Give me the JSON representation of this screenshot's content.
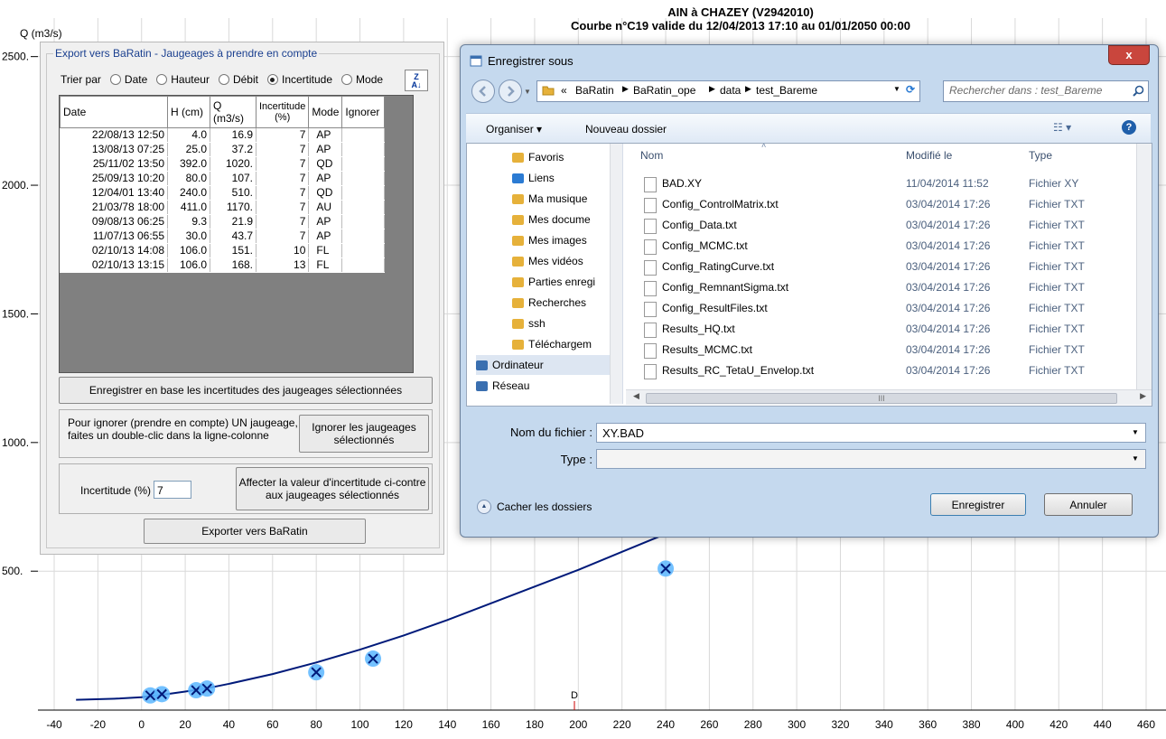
{
  "chart": {
    "title_line1": "AIN à CHAZEY (V2942010)",
    "title_line2": "Courbe n°C19 valide du 12/04/2013 17:10 au 01/01/2050 00:00",
    "y_axis_label": "Q (m3/s)",
    "d_marker": "D",
    "colors": {
      "curve": "#001a7a",
      "point": "#5bb6ff",
      "grid": "#d9d9d9"
    }
  },
  "chart_data": {
    "type": "scatter",
    "title": "AIN à CHAZEY (V2942010)",
    "subtitle": "Courbe n°C19 valide du 12/04/2013 17:10 au 01/01/2050 00:00",
    "xlabel": "",
    "ylabel": "Q (m3/s)",
    "xlim": [
      -45,
      465
    ],
    "ylim": [
      -40,
      2720
    ],
    "x_ticks": [
      -40,
      -20,
      0,
      20,
      40,
      60,
      80,
      100,
      120,
      140,
      160,
      180,
      200,
      220,
      240,
      260,
      280,
      300,
      320,
      340,
      360,
      380,
      400,
      420,
      440,
      460
    ],
    "x_tick_labels": [
      "-40",
      "-20",
      "0",
      "20",
      "40",
      "60",
      "80",
      "100",
      "120",
      "140",
      "160",
      "180",
      "200",
      "220",
      "240",
      "260",
      "280",
      "300",
      "320",
      "340",
      "360",
      "380",
      "400",
      "420",
      "440",
      "460"
    ],
    "y_ticks": [
      500,
      1000,
      1500,
      2000,
      2500
    ],
    "y_tick_labels": [
      "500.",
      "1000.",
      "1500.",
      "2000.",
      "2500."
    ],
    "grid": true,
    "series": [
      {
        "kind": "curve",
        "x": [
          -30,
          -10,
          0,
          10,
          20,
          30,
          40,
          60,
          80,
          100,
          120,
          140,
          160,
          180,
          200,
          220,
          240,
          260,
          280,
          300,
          320,
          340,
          360,
          380,
          400,
          420,
          440,
          460
        ],
        "y": [
          0,
          5,
          10,
          20,
          32,
          45,
          62,
          100,
          145,
          195,
          250,
          310,
          375,
          440,
          505,
          575,
          645,
          730,
          810,
          890,
          970,
          1060,
          1140,
          1230,
          1320,
          1410,
          1500,
          1600
        ]
      },
      {
        "kind": "points",
        "x": [
          4.0,
          9.3,
          25.0,
          30.0,
          80.0,
          106.0,
          240.0
        ],
        "y": [
          16.9,
          21.9,
          37.2,
          43.7,
          107,
          160,
          510
        ]
      }
    ]
  },
  "panel": {
    "group_title": "Export vers BaRatin - Jaugeages à prendre en compte",
    "sort_label": "Trier par",
    "sort_options": [
      "Date",
      "Hauteur",
      "Débit",
      "Incertitude",
      "Mode"
    ],
    "sort_selected": "Incertitude",
    "sort_button": "Z A",
    "columns": [
      "Date",
      "H (cm)",
      "Q (m3/s)",
      "Incertitude (%)",
      "Mode",
      "Ignorer"
    ],
    "rows": [
      [
        "22/08/13 12:50",
        "4.0",
        "16.9",
        "7",
        "AP",
        ""
      ],
      [
        "13/08/13 07:25",
        "25.0",
        "37.2",
        "7",
        "AP",
        ""
      ],
      [
        "25/11/02 13:50",
        "392.0",
        "1020.",
        "7",
        "QD",
        ""
      ],
      [
        "25/09/13 10:20",
        "80.0",
        "107.",
        "7",
        "AP",
        ""
      ],
      [
        "12/04/01 13:40",
        "240.0",
        "510.",
        "7",
        "QD",
        ""
      ],
      [
        "21/03/78 18:00",
        "411.0",
        "1170.",
        "7",
        "AU",
        ""
      ],
      [
        "09/08/13 06:25",
        "9.3",
        "21.9",
        "7",
        "AP",
        ""
      ],
      [
        "11/07/13 06:55",
        "30.0",
        "43.7",
        "7",
        "AP",
        ""
      ],
      [
        "02/10/13 14:08",
        "106.0",
        "151.",
        "10",
        "FL",
        ""
      ],
      [
        "02/10/13 13:15",
        "106.0",
        "168.",
        "13",
        "FL",
        ""
      ]
    ],
    "save_uncert_button": "Enregistrer en base les incertitudes des jaugeages sélectionnées",
    "ignore_hint": "Pour ignorer (prendre en compte) UN jaugeage, faites un double-clic dans la ligne-colonne",
    "ignore_button": "Ignorer les jaugeages sélectionnés",
    "uncert_label": "Incertitude (%)",
    "uncert_value": "7",
    "assign_button": "Affecter la valeur d'incertitude ci-contre aux jaugeages sélectionnés",
    "export_button": "Exporter vers BaRatin"
  },
  "dialog": {
    "title": "Enregistrer sous",
    "close": "x",
    "breadcrumb": [
      "«",
      "BaRatin",
      "BaRatin_ope",
      "data",
      "test_Bareme"
    ],
    "search_placeholder": "Rechercher dans : test_Bareme",
    "organize": "Organiser ▾",
    "new_folder": "Nouveau dossier",
    "tree": [
      {
        "label": "Favoris",
        "icon": "star-folder-icon",
        "color": "#e6b13a"
      },
      {
        "label": "Liens",
        "icon": "links-icon",
        "color": "#2b7bd3"
      },
      {
        "label": "Ma musique",
        "icon": "music-icon",
        "color": "#e6b13a"
      },
      {
        "label": "Mes docume",
        "icon": "documents-icon",
        "color": "#e6b13a"
      },
      {
        "label": "Mes images",
        "icon": "images-icon",
        "color": "#e6b13a"
      },
      {
        "label": "Mes vidéos",
        "icon": "videos-icon",
        "color": "#e6b13a"
      },
      {
        "label": "Parties enregi",
        "icon": "saved-games-icon",
        "color": "#e6b13a"
      },
      {
        "label": "Recherches",
        "icon": "searches-icon",
        "color": "#e6b13a"
      },
      {
        "label": "ssh",
        "icon": "folder-icon",
        "color": "#e6b13a"
      },
      {
        "label": "Téléchargem",
        "icon": "downloads-icon",
        "color": "#e6b13a"
      },
      {
        "label": "Ordinateur",
        "icon": "computer-icon",
        "color": "#3a6fb0"
      },
      {
        "label": "Réseau",
        "icon": "network-icon",
        "color": "#3a6fb0"
      }
    ],
    "headers": [
      "Nom",
      "Modifié le",
      "Type"
    ],
    "files": [
      {
        "name": "BAD.XY",
        "date": "11/04/2014 11:52",
        "type": "Fichier XY"
      },
      {
        "name": "Config_ControlMatrix.txt",
        "date": "03/04/2014 17:26",
        "type": "Fichier TXT"
      },
      {
        "name": "Config_Data.txt",
        "date": "03/04/2014 17:26",
        "type": "Fichier TXT"
      },
      {
        "name": "Config_MCMC.txt",
        "date": "03/04/2014 17:26",
        "type": "Fichier TXT"
      },
      {
        "name": "Config_RatingCurve.txt",
        "date": "03/04/2014 17:26",
        "type": "Fichier TXT"
      },
      {
        "name": "Config_RemnantSigma.txt",
        "date": "03/04/2014 17:26",
        "type": "Fichier TXT"
      },
      {
        "name": "Config_ResultFiles.txt",
        "date": "03/04/2014 17:26",
        "type": "Fichier TXT"
      },
      {
        "name": "Results_HQ.txt",
        "date": "03/04/2014 17:26",
        "type": "Fichier TXT"
      },
      {
        "name": "Results_MCMC.txt",
        "date": "03/04/2014 17:26",
        "type": "Fichier TXT"
      },
      {
        "name": "Results_RC_TetaU_Envelop.txt",
        "date": "03/04/2014 17:26",
        "type": "Fichier TXT"
      }
    ],
    "scroll_mark": "III",
    "filename_label": "Nom du fichier :",
    "filename_value": "XY.BAD",
    "type_label": "Type :",
    "type_value": "",
    "hide_folders": "Cacher les dossiers",
    "save_button": "Enregistrer",
    "cancel_button": "Annuler"
  }
}
